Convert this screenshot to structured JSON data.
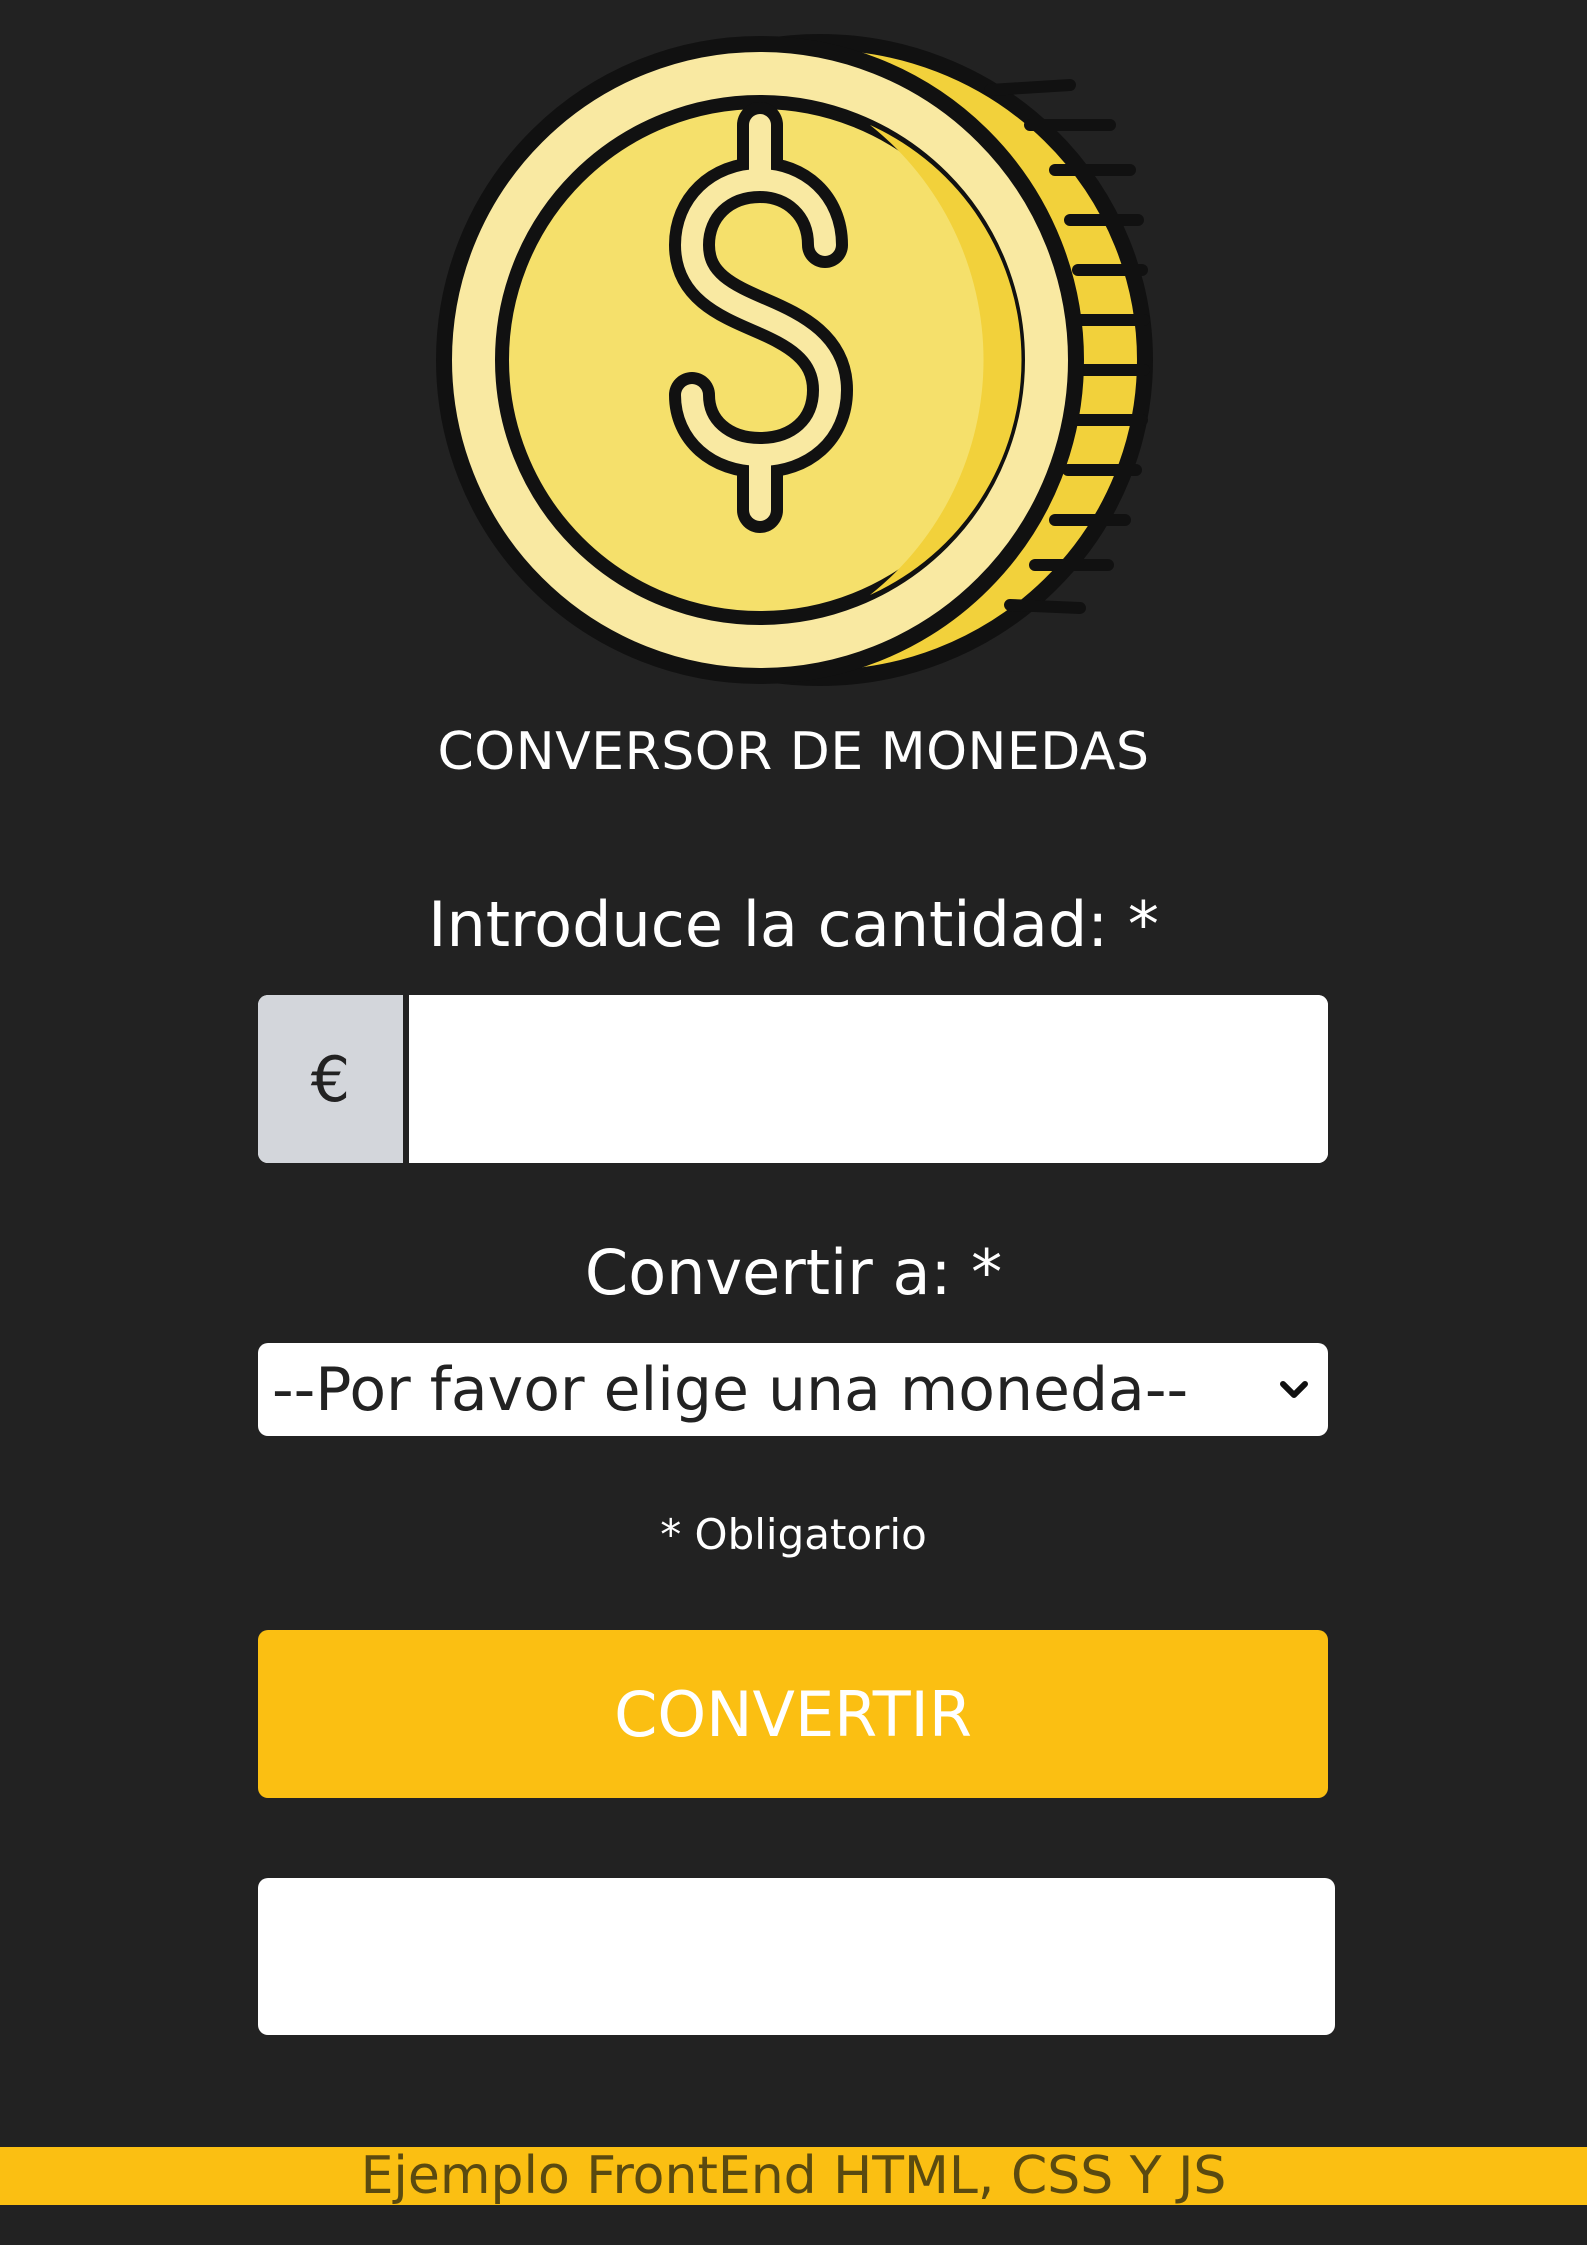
{
  "app": {
    "title": "CONVERSOR DE MONEDAS",
    "logo_icon": "dollar-coin-icon"
  },
  "form": {
    "amount_label": "Introduce la cantidad: *",
    "currency_symbol": "€",
    "amount_value": "",
    "convert_to_label": "Convertir a: *",
    "currency_select_value": "--Por favor elige una moneda--",
    "required_note": "* Obligatorio",
    "convert_button_label": "CONVERTIR",
    "result_text": ""
  },
  "footer": {
    "text": "Ejemplo FrontEnd HTML, CSS Y JS"
  },
  "colors": {
    "background": "#222222",
    "accent": "#fbbf12",
    "coin_light": "#f9e9a2",
    "coin_mid": "#f5e06b",
    "coin_dark": "#f2d13b"
  }
}
